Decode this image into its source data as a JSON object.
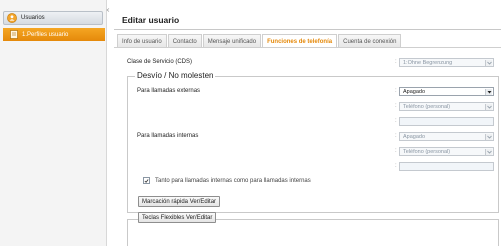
{
  "sidebar": {
    "header_label": "Usuarios",
    "item_label": "1.Perfiles usuario"
  },
  "main": {
    "title": "Editar usuario",
    "tabs": [
      {
        "label": "Info de usuario",
        "active": false
      },
      {
        "label": "Contacto",
        "active": false
      },
      {
        "label": "Mensaje unificado",
        "active": false
      },
      {
        "label": "Funciones de telefonía",
        "active": true
      },
      {
        "label": "Cuenta de conexión",
        "active": false
      }
    ],
    "cos": {
      "label": "Clase de Servicio (CDS)",
      "value": "1:Ohne Begrenzung"
    },
    "dnd": {
      "legend": "Desvío / No molesten",
      "external": {
        "label": "Para llamadas externas",
        "mode": "Apagado",
        "target": "Teléfono (personal)",
        "number": ""
      },
      "internal": {
        "label": "Para llamadas internas",
        "mode": "Apagado",
        "target": "Teléfono (personal)",
        "number": ""
      },
      "both_checkbox": {
        "label": "Tanto para llamadas internas como para llamadas internas",
        "checked": true
      }
    },
    "buttons": {
      "speed_dial": "Marcación rápida Ver/Editar",
      "flex_keys": "Teclas Flexibles Ver/Editar"
    },
    "colon": ":"
  }
}
